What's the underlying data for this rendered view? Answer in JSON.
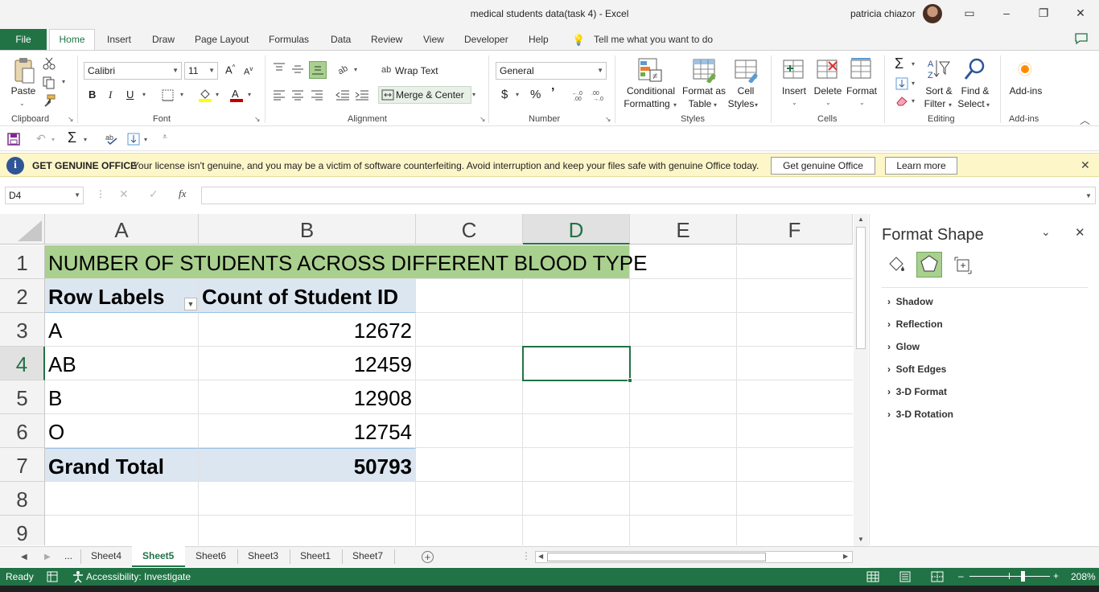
{
  "window": {
    "title": "medical students data(task 4)  -  Excel",
    "user": "patricia chiazor"
  },
  "tabs": [
    "File",
    "Home",
    "Insert",
    "Draw",
    "Page Layout",
    "Formulas",
    "Data",
    "Review",
    "View",
    "Developer",
    "Help"
  ],
  "tell_me": "Tell me what you want to do",
  "ribbon": {
    "clipboard": {
      "paste": "Paste",
      "label": "Clipboard"
    },
    "font": {
      "name": "Calibri",
      "size": "11",
      "label": "Font",
      "bold": "B",
      "italic": "I",
      "underline": "U"
    },
    "alignment": {
      "wrap": "Wrap Text",
      "merge": "Merge & Center",
      "label": "Alignment"
    },
    "number": {
      "format": "General",
      "label": "Number",
      "currency": "$",
      "percent": "%",
      "comma": "’"
    },
    "styles": {
      "cond1": "Conditional",
      "cond2": "Formatting",
      "fmt1": "Format as",
      "fmt2": "Table",
      "cell1": "Cell",
      "cell2": "Styles",
      "label": "Styles"
    },
    "cells": {
      "insert": "Insert",
      "delete": "Delete",
      "format": "Format",
      "label": "Cells"
    },
    "editing": {
      "sort1": "Sort &",
      "sort2": "Filter",
      "find1": "Find &",
      "find2": "Select",
      "label": "Editing"
    },
    "addins": {
      "addins": "Add-ins",
      "label": "Add-ins"
    }
  },
  "message_bar": {
    "heading": "GET GENUINE OFFICE",
    "text": "Your license isn't genuine, and you may be a victim of software counterfeiting. Avoid interruption and keep your files safe with genuine Office today.",
    "btn_genuine": "Get genuine Office",
    "btn_learn": "Learn more"
  },
  "formula_bar": {
    "name_box": "D4",
    "fx": "fx",
    "formula": ""
  },
  "sheet": {
    "columns": [
      "A",
      "B",
      "C",
      "D",
      "E",
      "F"
    ],
    "rows": [
      "1",
      "2",
      "3",
      "4",
      "5",
      "6",
      "7",
      "8",
      "9"
    ],
    "title": "NUMBER OF STUDENTS ACROSS DIFFERENT BLOOD TYPE",
    "header_row_labels": "Row Labels",
    "header_count": "Count of Student ID",
    "data": [
      {
        "label": "A",
        "value": "12672"
      },
      {
        "label": "AB",
        "value": "12459"
      },
      {
        "label": "B",
        "value": "12908"
      },
      {
        "label": "O",
        "value": "12754"
      }
    ],
    "total_label": "Grand Total",
    "total_value": "50793",
    "selected_cell": "D4"
  },
  "format_pane": {
    "title": "Format Shape",
    "sections": [
      "Shadow",
      "Reflection",
      "Glow",
      "Soft Edges",
      "3-D Format",
      "3-D Rotation"
    ]
  },
  "sheet_tabs": {
    "more": "...",
    "tabs": [
      "Sheet4",
      "Sheet5",
      "Sheet6",
      "Sheet3",
      "Sheet1",
      "Sheet7"
    ],
    "active": "Sheet5"
  },
  "status": {
    "ready": "Ready",
    "accessibility": "Accessibility: Investigate",
    "zoom": "208%"
  },
  "colors": {
    "excel_green": "#217346",
    "title_fill": "#a9d08e",
    "pivot_header": "#dce6f1",
    "message_bar": "#fdf6c8"
  }
}
